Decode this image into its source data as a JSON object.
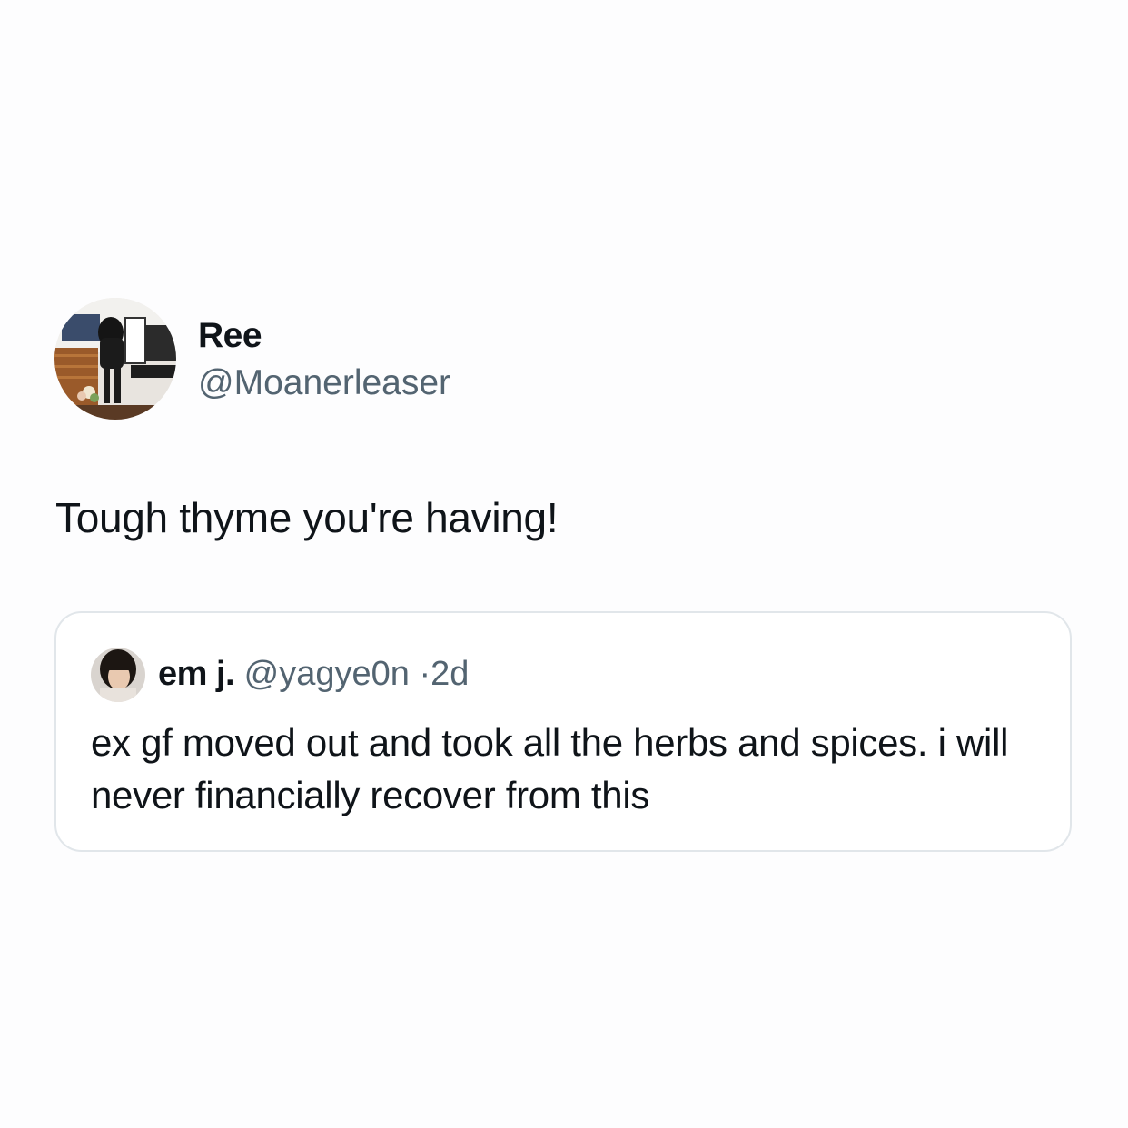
{
  "tweet": {
    "display_name": "Ree",
    "handle": "@Moanerleaser",
    "text": "Tough thyme you're having!",
    "avatar_icon": "profile-photo-icon"
  },
  "quote": {
    "display_name": "em j.",
    "handle": "@yagye0n",
    "separator": "·",
    "time": "2d",
    "text": "ex gf moved out and took all the herbs and spices. i will never financially recover from this",
    "avatar_icon": "profile-photo-icon"
  },
  "colors": {
    "background": "#fdfdfe",
    "text_primary": "#0f1419",
    "text_secondary": "#536471",
    "card_border": "#e1e6ea"
  }
}
